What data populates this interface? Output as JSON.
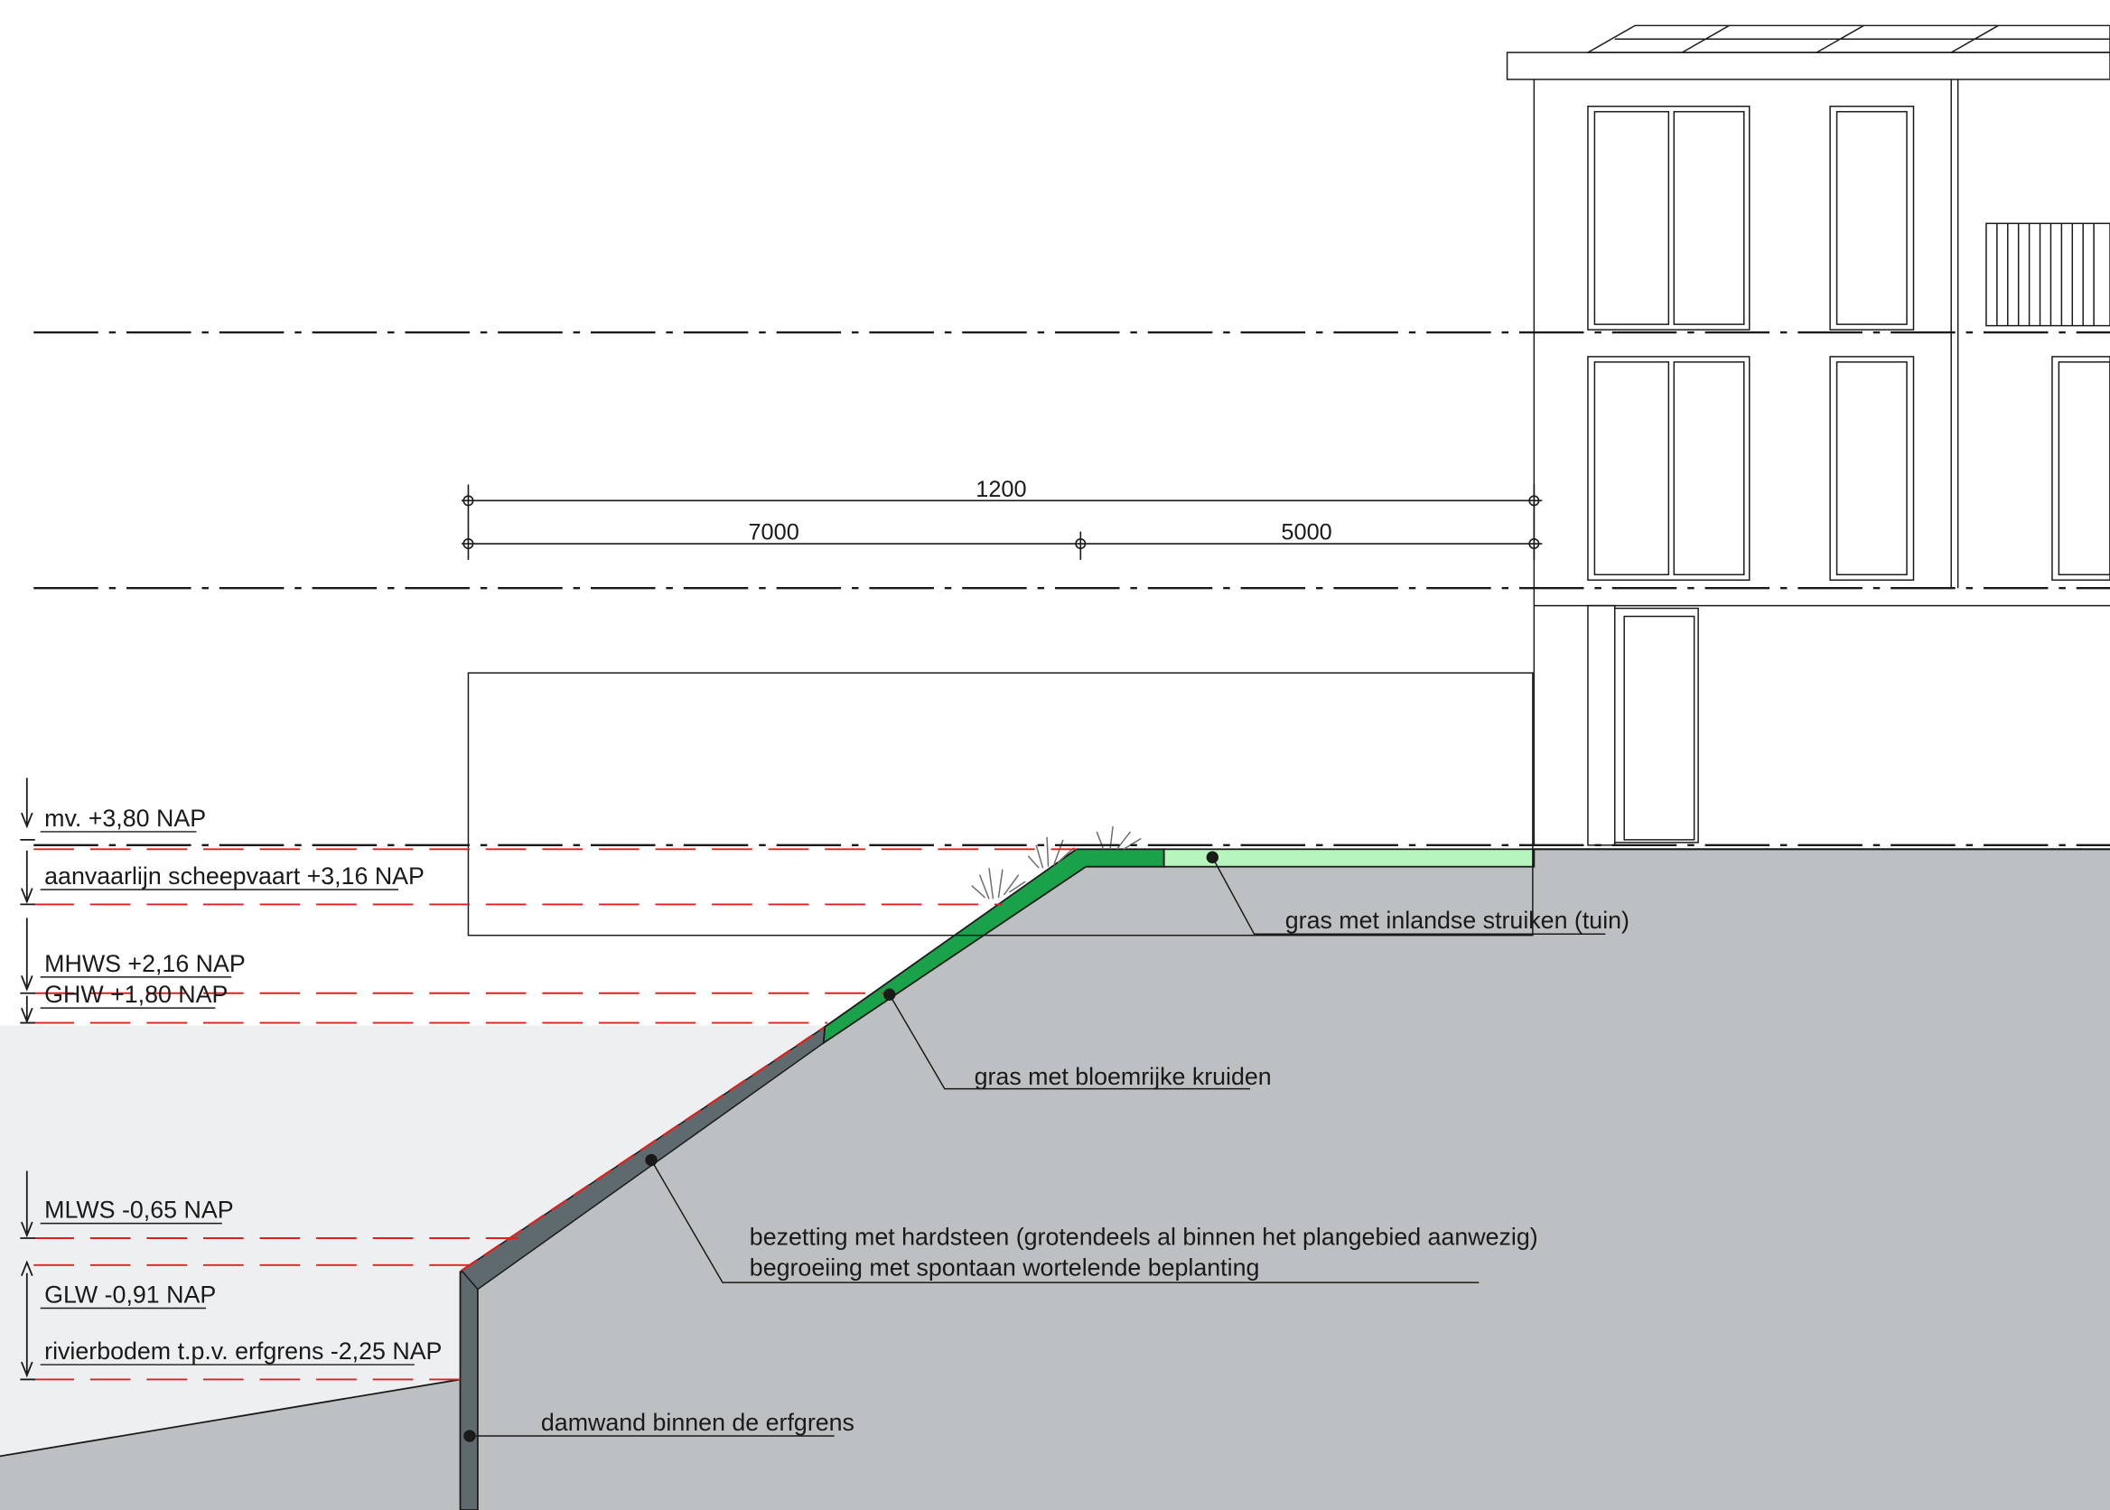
{
  "dimensions": {
    "total": "1200",
    "left_segment": "7000",
    "right_segment": "5000"
  },
  "levels": {
    "mv": "mv. +3,80 NAP",
    "aanvaarlijn": "aanvaarlijn scheepvaart +3,16 NAP",
    "mhws": "MHWS +2,16 NAP",
    "ghw": "GHW +1,80 NAP",
    "mlws": "MLWS -0,65 NAP",
    "glw": "GLW -0,91 NAP",
    "rivierbodem": "rivierbodem t.p.v. erfgrens -2,25 NAP"
  },
  "callouts": {
    "tuin": "gras met inlandse struiken (tuin)",
    "kruiden": "gras met bloemrijke kruiden",
    "hardsteen_line1": "bezetting met hardsteen (grotendeels al binnen het plangebied aanwezig)",
    "hardsteen_line2": "begroeiing met spontaan wortelende beplanting",
    "damwand": "damwand binnen de erfgrens"
  },
  "colors": {
    "ground": "#bcc0c3",
    "water": "#eeeff1",
    "grass_dark": "#1aa24a",
    "grass_light": "#b6f5bc",
    "revetment": "#5f6a6e",
    "water_level_line": "#e0201e",
    "linework": "#1a1a1a"
  }
}
